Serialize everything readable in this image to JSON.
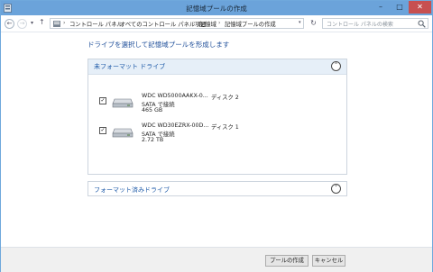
{
  "window": {
    "title": "記憶域プールの作成",
    "minimize": "–",
    "maximize": "□",
    "close": "✕"
  },
  "address_bar": {
    "breadcrumbs": [
      "コントロール パネル",
      "すべてのコントロール パネル項目",
      "記憶域",
      "記憶域プールの作成"
    ],
    "separator": "›",
    "search_placeholder": "コントロール パネルの検索"
  },
  "main": {
    "heading": "ドライブを選択して記憶域プールを形成します",
    "unformatted_section": {
      "label": "未フォーマット ドライブ",
      "expanded": true,
      "drives": [
        {
          "checked": true,
          "name": "WDC WD5000AAKX-0...",
          "disk": "ディスク 2",
          "connection": "SATA で接続",
          "size": "465 GB"
        },
        {
          "checked": true,
          "name": "WDC WD30EZRX-00D...",
          "disk": "ディスク 1",
          "connection": "SATA で接続",
          "size": "2.72 TB"
        }
      ]
    },
    "formatted_section": {
      "label": "フォーマット済みドライブ",
      "expanded": false
    }
  },
  "footer": {
    "create_label": "プールの作成",
    "cancel_label": "キャンセル"
  }
}
